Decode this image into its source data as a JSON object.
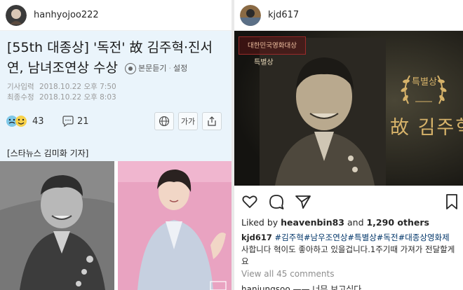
{
  "left_post": {
    "username": "hanhyojoo222",
    "article": {
      "title": "[55th 대종상] '독전' 故 김주혁·진서연, 남녀조연상 수상",
      "listen_label": "본문듣기",
      "settings_label": "설정",
      "published_label": "기사입력",
      "published_value": "2018.10.22 오후 7:50",
      "modified_label": "최종수정",
      "modified_value": "2018.10.22 오후 8:03",
      "reaction_count": "43",
      "comment_count": "21",
      "font_button_label": "가가",
      "reporter": "[스타뉴스 김미화 기자]"
    }
  },
  "right_post": {
    "username": "kjd617",
    "image_overlay": {
      "event_logo": "대한민국영화대상",
      "special_award_tag": "특별상",
      "award_label": "특별상",
      "name_label": "故 김주혁"
    },
    "likes_prefix": "Liked by ",
    "likes_user": "heavenbin83",
    "likes_middle": " and ",
    "likes_count": "1,290 others",
    "caption_user": "kjd617",
    "caption_tags": "#김주혁#남우조연상#특별상#독전#대종상영화제",
    "caption_text": " 사합니다 혁이도 좋아하고 있을겁니다.1주기때 가져가 전달할게요",
    "view_comments": "View all 45 comments",
    "comment_partial": "hanjungsoo —— 너무 보고싶다"
  },
  "colors": {
    "article_bg": "#eaf4fb",
    "hashtag": "#003569",
    "muted": "#8e8e8e",
    "award_gold": "#d7b36a"
  }
}
